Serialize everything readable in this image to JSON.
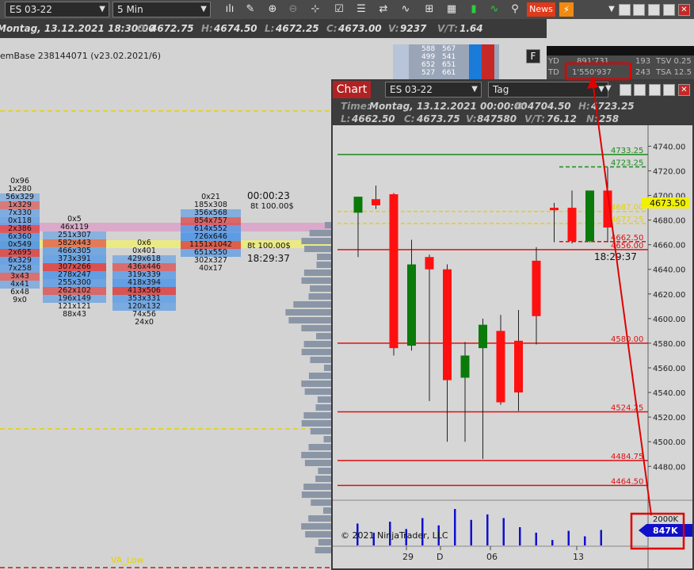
{
  "toolbar": {
    "instrument": "ES 03-22",
    "interval": "5 Min",
    "news": "News"
  },
  "info": {
    "date": "Montag, 13.12.2021 18:30:00",
    "o_label": "O:",
    "o": "4672.75",
    "h_label": "H:",
    "h": "4674.50",
    "l_label": "L:",
    "l": "4672.25",
    "c_label": "C:",
    "c": "4673.00",
    "v_label": "V:",
    "v": "9237",
    "vt_label": "V/T:",
    "vt": "1.64"
  },
  "left": {
    "system": "emBase 238144071 (v23.02.2021/6)",
    "clock": "00:00:23",
    "ticks1": "8t 100.00$",
    "ticks2": "8t 100.00$",
    "time": "18:29:37",
    "va_low": "VA_Low"
  },
  "timesales": {
    "f": "F",
    "yd_label": "YD",
    "yd": "891'731",
    "yd_n": "193",
    "yd_tsv": "TSV 0.25",
    "td_label": "TD",
    "td": "1'550'937",
    "td_n": "243",
    "td_tsa": "TSA 12.5"
  },
  "ladder": [
    [
      "588",
      "567"
    ],
    [
      "499",
      "541"
    ],
    [
      "652",
      "651"
    ],
    [
      "527",
      "661"
    ]
  ],
  "chart": {
    "title": "Chart",
    "instrument": "ES 03-22",
    "interval": "Tag",
    "time_label": "Time:",
    "time": "Montag, 13.12.2021 00:00:00",
    "o_label": "O:",
    "o": "4704.50",
    "h_label": "H:",
    "h": "4723.25",
    "l_label": "L:",
    "l": "4662.50",
    "c_label": "C:",
    "c": "4673.75",
    "v_label": "V:",
    "v": "847580",
    "vt_label": "V/T:",
    "vt": "76.12",
    "n_label": "N:",
    "n": "258",
    "countdown": "18:29:37",
    "copyright": "© 2021 NinjaTrader, LLC",
    "price_tag": "4673.50",
    "vol_max": "2000K",
    "vol_tag": "847K"
  },
  "chart_data": {
    "type": "candlestick",
    "y_ticks": [
      "4740.00",
      "4720.00",
      "4700.00",
      "4680.00",
      "4660.00",
      "4640.00",
      "4620.00",
      "4600.00",
      "4580.00",
      "4560.00",
      "4540.00",
      "4520.00",
      "4500.00",
      "4480.00"
    ],
    "x_ticks": [
      "29",
      "D",
      "06",
      "13"
    ],
    "ylim": [
      4466,
      4748
    ],
    "candles": [
      {
        "o": 4686,
        "h": 4694,
        "l": 4650,
        "c": 4699
      },
      {
        "o": 4697,
        "h": 4708,
        "l": 4689,
        "c": 4692
      },
      {
        "o": 4701,
        "h": 4702,
        "l": 4570,
        "c": 4576
      },
      {
        "o": 4578,
        "h": 4664,
        "l": 4574,
        "c": 4644
      },
      {
        "o": 4650,
        "h": 4652,
        "l": 4533,
        "c": 4640
      },
      {
        "o": 4640,
        "h": 4644,
        "l": 4500,
        "c": 4550
      },
      {
        "o": 4552,
        "h": 4581,
        "l": 4500,
        "c": 4570
      },
      {
        "o": 4576,
        "h": 4600,
        "l": 4486,
        "c": 4595
      },
      {
        "o": 4590,
        "h": 4603,
        "l": 4530,
        "c": 4532
      },
      {
        "o": 4582,
        "h": 4607,
        "l": 4525,
        "c": 4540
      },
      {
        "o": 4647,
        "h": 4658,
        "l": 4579,
        "c": 4602
      },
      {
        "o": 4690,
        "h": 4694,
        "l": 4662,
        "c": 4688
      },
      {
        "o": 4690,
        "h": 4704,
        "l": 4661,
        "c": 4663
      },
      {
        "o": 4663,
        "h": 4703,
        "l": 4662,
        "c": 4704
      },
      {
        "o": 4704,
        "h": 4723,
        "l": 4662,
        "c": 4674
      }
    ],
    "levels": [
      {
        "label": "4733.25",
        "value": 4733.25,
        "color": "#1a8a1a"
      },
      {
        "label": "4723.25",
        "value": 4723.25,
        "color": "#1a8a1a"
      },
      {
        "label": "4687.00",
        "value": 4687,
        "color": "#e6d200"
      },
      {
        "label": "4677.25",
        "value": 4677.25,
        "color": "#e6d200"
      },
      {
        "label": "4662.50",
        "value": 4662.5,
        "color": "#dd1111"
      },
      {
        "label": "4656.00",
        "value": 4656,
        "color": "#dd1111"
      },
      {
        "label": "4580.00",
        "value": 4580,
        "color": "#dd1111"
      },
      {
        "label": "4524.25",
        "value": 4524.25,
        "color": "#dd1111"
      },
      {
        "label": "4484.75",
        "value": 4484.75,
        "color": "#dd1111"
      },
      {
        "label": "4464.50",
        "value": 4464.5,
        "color": "#dd1111"
      }
    ],
    "volume": [
      1200,
      700,
      1300,
      900,
      1500,
      1100,
      2000,
      1400,
      1700,
      1500,
      1000,
      700,
      300,
      800,
      500,
      847
    ]
  },
  "footprint": [
    {
      "rows": [
        "0x96",
        "1x280",
        "56x329",
        "1x329",
        "7x330",
        "0x118",
        "2x386",
        "6x360",
        "0x549",
        "2x695",
        "6x329",
        "7x258",
        "3x43",
        "4x41",
        "6x48",
        "9x0"
      ]
    },
    {
      "rows": [
        "0x5",
        "46x119",
        "251x307",
        "582x443",
        "466x305",
        "373x391",
        "307x266",
        "278x247",
        "255x300",
        "262x102",
        "196x149",
        "121x121",
        "88x43"
      ]
    },
    {
      "rows": [
        "0x6",
        "0x401",
        "429x618",
        "436x446",
        "319x339",
        "418x394",
        "413x506",
        "353x331",
        "120x132",
        "74x56",
        "24x0"
      ]
    },
    {
      "rows": [
        "0x21",
        "185x308",
        "356x568",
        "854x757",
        "614x552",
        "726x646",
        "1151x1042",
        "651x550",
        "302x327",
        "40x17"
      ]
    }
  ]
}
